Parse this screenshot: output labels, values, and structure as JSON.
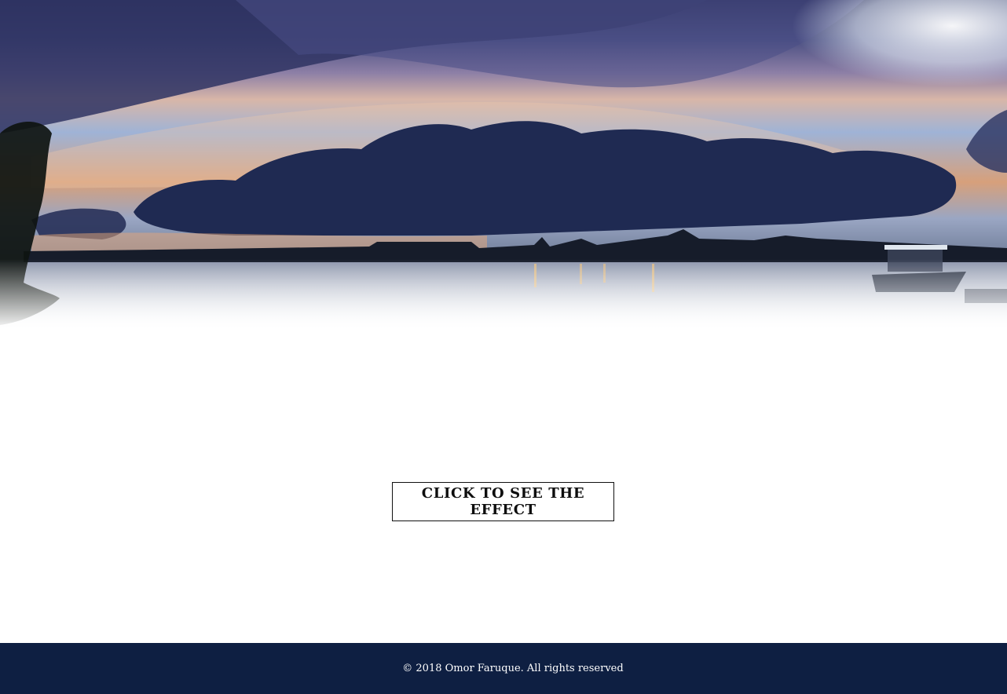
{
  "hero": {
    "image_description_icon": "sunset-lagoon-image"
  },
  "cta": {
    "label": "CLICK TO SEE THE EFFECT"
  },
  "footer": {
    "copyright": "© 2018 Omor Faruque. All rights reserved"
  },
  "colors": {
    "footer_bg": "#0e1f42",
    "button_border": "#111111",
    "page_bg": "#ffffff"
  }
}
